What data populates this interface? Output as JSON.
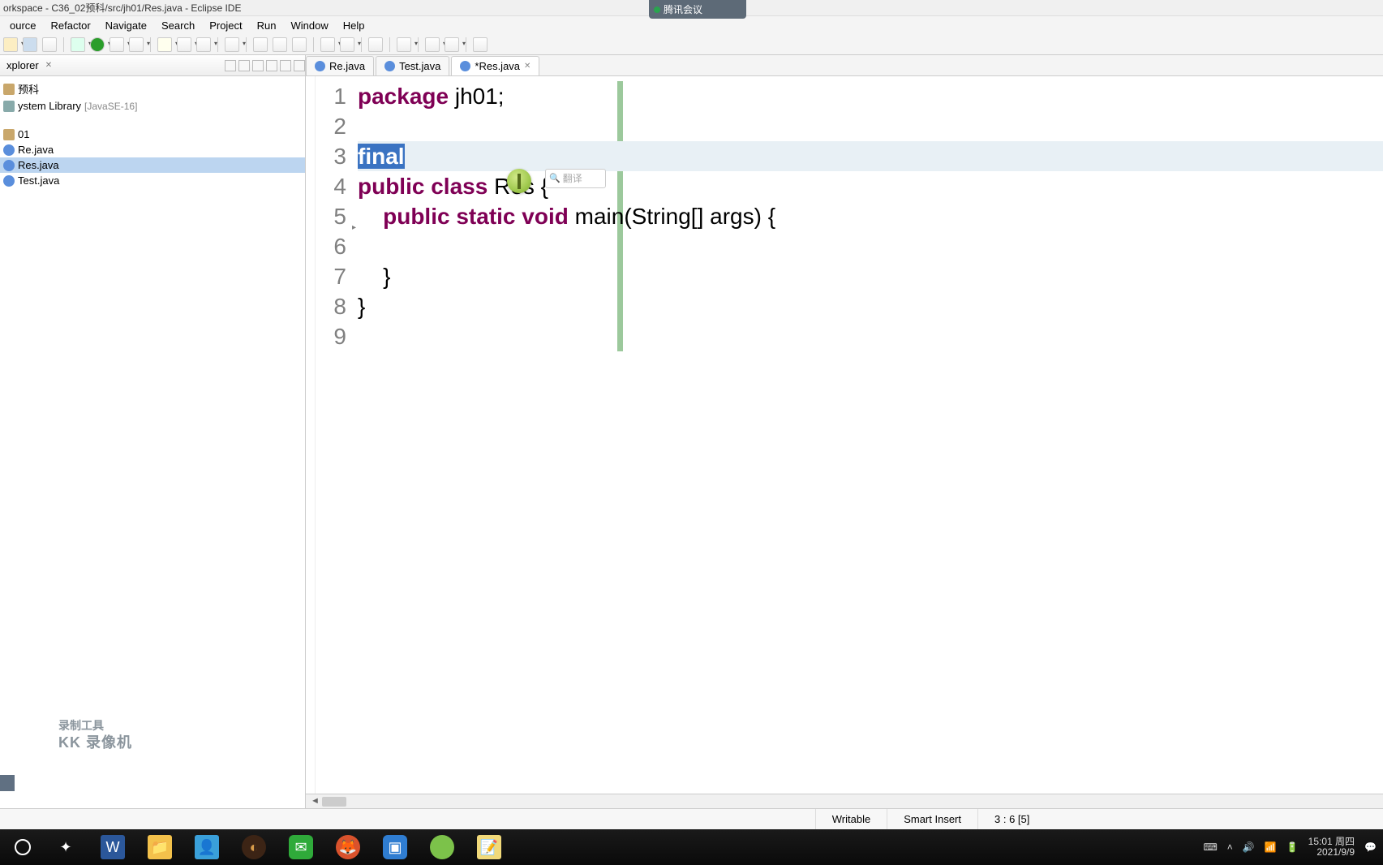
{
  "window": {
    "title": "orkspace - C36_02预科/src/jh01/Res.java - Eclipse IDE",
    "overlay_app": "腾讯会议"
  },
  "menu": [
    "ource",
    "Refactor",
    "Navigate",
    "Search",
    "Project",
    "Run",
    "Window",
    "Help"
  ],
  "explorer": {
    "title": "xplorer",
    "project": "预科",
    "library": "ystem Library",
    "library_ver": "[JavaSE-16]",
    "pkg": "01",
    "files": [
      "Re.java",
      "Res.java",
      "Test.java"
    ],
    "selected": 1
  },
  "editor": {
    "tabs": [
      {
        "label": "Re.java",
        "dirty": false,
        "active": false
      },
      {
        "label": "Test.java",
        "dirty": false,
        "active": false
      },
      {
        "label": "*Res.java",
        "dirty": true,
        "active": true
      }
    ],
    "lines": {
      "1": {
        "kw1": "package",
        "rest": " jh01;"
      },
      "2": {
        "rest": ""
      },
      "3": {
        "sel": "final",
        "is_current": true
      },
      "4": {
        "kw1": "public",
        "kw2": "class",
        "rest": " Res {"
      },
      "5": {
        "indent": "    ",
        "kw1": "public",
        "kw2": "static",
        "kw3": "void",
        "rest": " main(String[] args) {"
      },
      "6": {
        "rest": ""
      },
      "7": {
        "indent": "    ",
        "rest": "}"
      },
      "8": {
        "rest": "}"
      },
      "9": {
        "rest": ""
      }
    },
    "search_hint": "翻译",
    "green_cursor_char": "I"
  },
  "status": {
    "writable": "Writable",
    "insert": "Smart Insert",
    "pos": "3 : 6 [5]"
  },
  "taskbar": {
    "clock_time": "15:01",
    "clock_day": "周四",
    "clock_date": "2021/9/9"
  },
  "watermark": {
    "l1": "录制工具",
    "l2": "KK 录像机"
  }
}
